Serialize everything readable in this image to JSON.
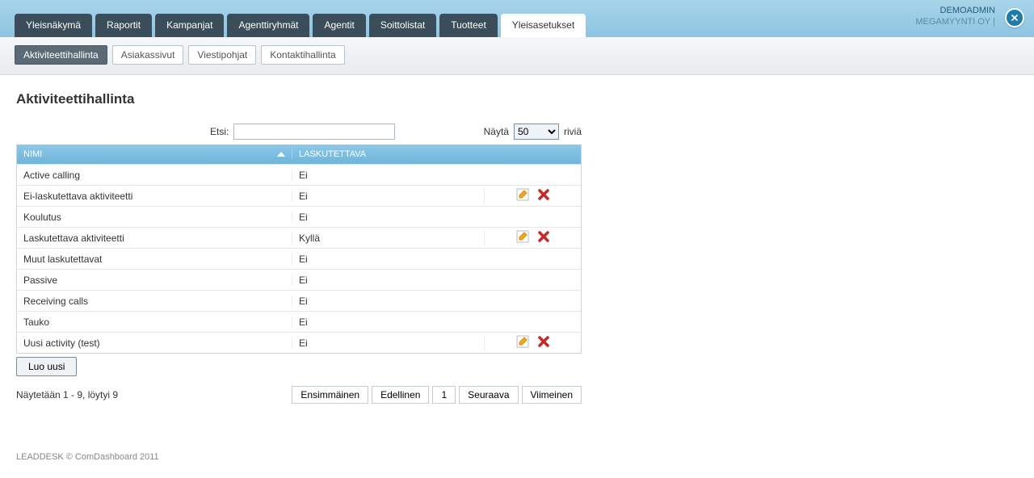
{
  "user": {
    "name": "DEMOADMIN",
    "org": "MEGAMYYNTI OY |"
  },
  "tabs": [
    {
      "label": "Yleisnäkymä"
    },
    {
      "label": "Raportit"
    },
    {
      "label": "Kampanjat"
    },
    {
      "label": "Agenttiryhmät"
    },
    {
      "label": "Agentit"
    },
    {
      "label": "Soittolistat"
    },
    {
      "label": "Tuotteet"
    },
    {
      "label": "Yleisasetukset",
      "active": true
    }
  ],
  "subtabs": [
    {
      "label": "Aktiviteettihallinta",
      "active": true
    },
    {
      "label": "Asiakassivut"
    },
    {
      "label": "Viestipohjat"
    },
    {
      "label": "Kontaktihallinta"
    }
  ],
  "page_title": "Aktiviteettihallinta",
  "search_label": "Etsi:",
  "rows_label_pre": "Näytä",
  "rows_label_post": "riviä",
  "rows_value": "50",
  "columns": {
    "name": "NIMI",
    "billable": "LASKUTETTAVA"
  },
  "rows": [
    {
      "name": "Active calling",
      "billable": "Ei",
      "editable": false
    },
    {
      "name": "Ei-laskutettava aktiviteetti",
      "billable": "Ei",
      "editable": true
    },
    {
      "name": "Koulutus",
      "billable": "Ei",
      "editable": false
    },
    {
      "name": "Laskutettava aktiviteetti",
      "billable": "Kyllä",
      "editable": true
    },
    {
      "name": "Muut laskutettavat",
      "billable": "Ei",
      "editable": false
    },
    {
      "name": "Passive",
      "billable": "Ei",
      "editable": false
    },
    {
      "name": "Receiving calls",
      "billable": "Ei",
      "editable": false
    },
    {
      "name": "Tauko",
      "billable": "Ei",
      "editable": false
    },
    {
      "name": "Uusi activity (test)",
      "billable": "Ei",
      "editable": true
    }
  ],
  "create_label": "Luo uusi",
  "result_info": "Näytetään 1 - 9, löytyi 9",
  "pager": {
    "first": "Ensimmäinen",
    "prev": "Edellinen",
    "page": "1",
    "next": "Seuraava",
    "last": "Viimeinen"
  },
  "footer": "LEADDESK  © ComDashboard 2011"
}
